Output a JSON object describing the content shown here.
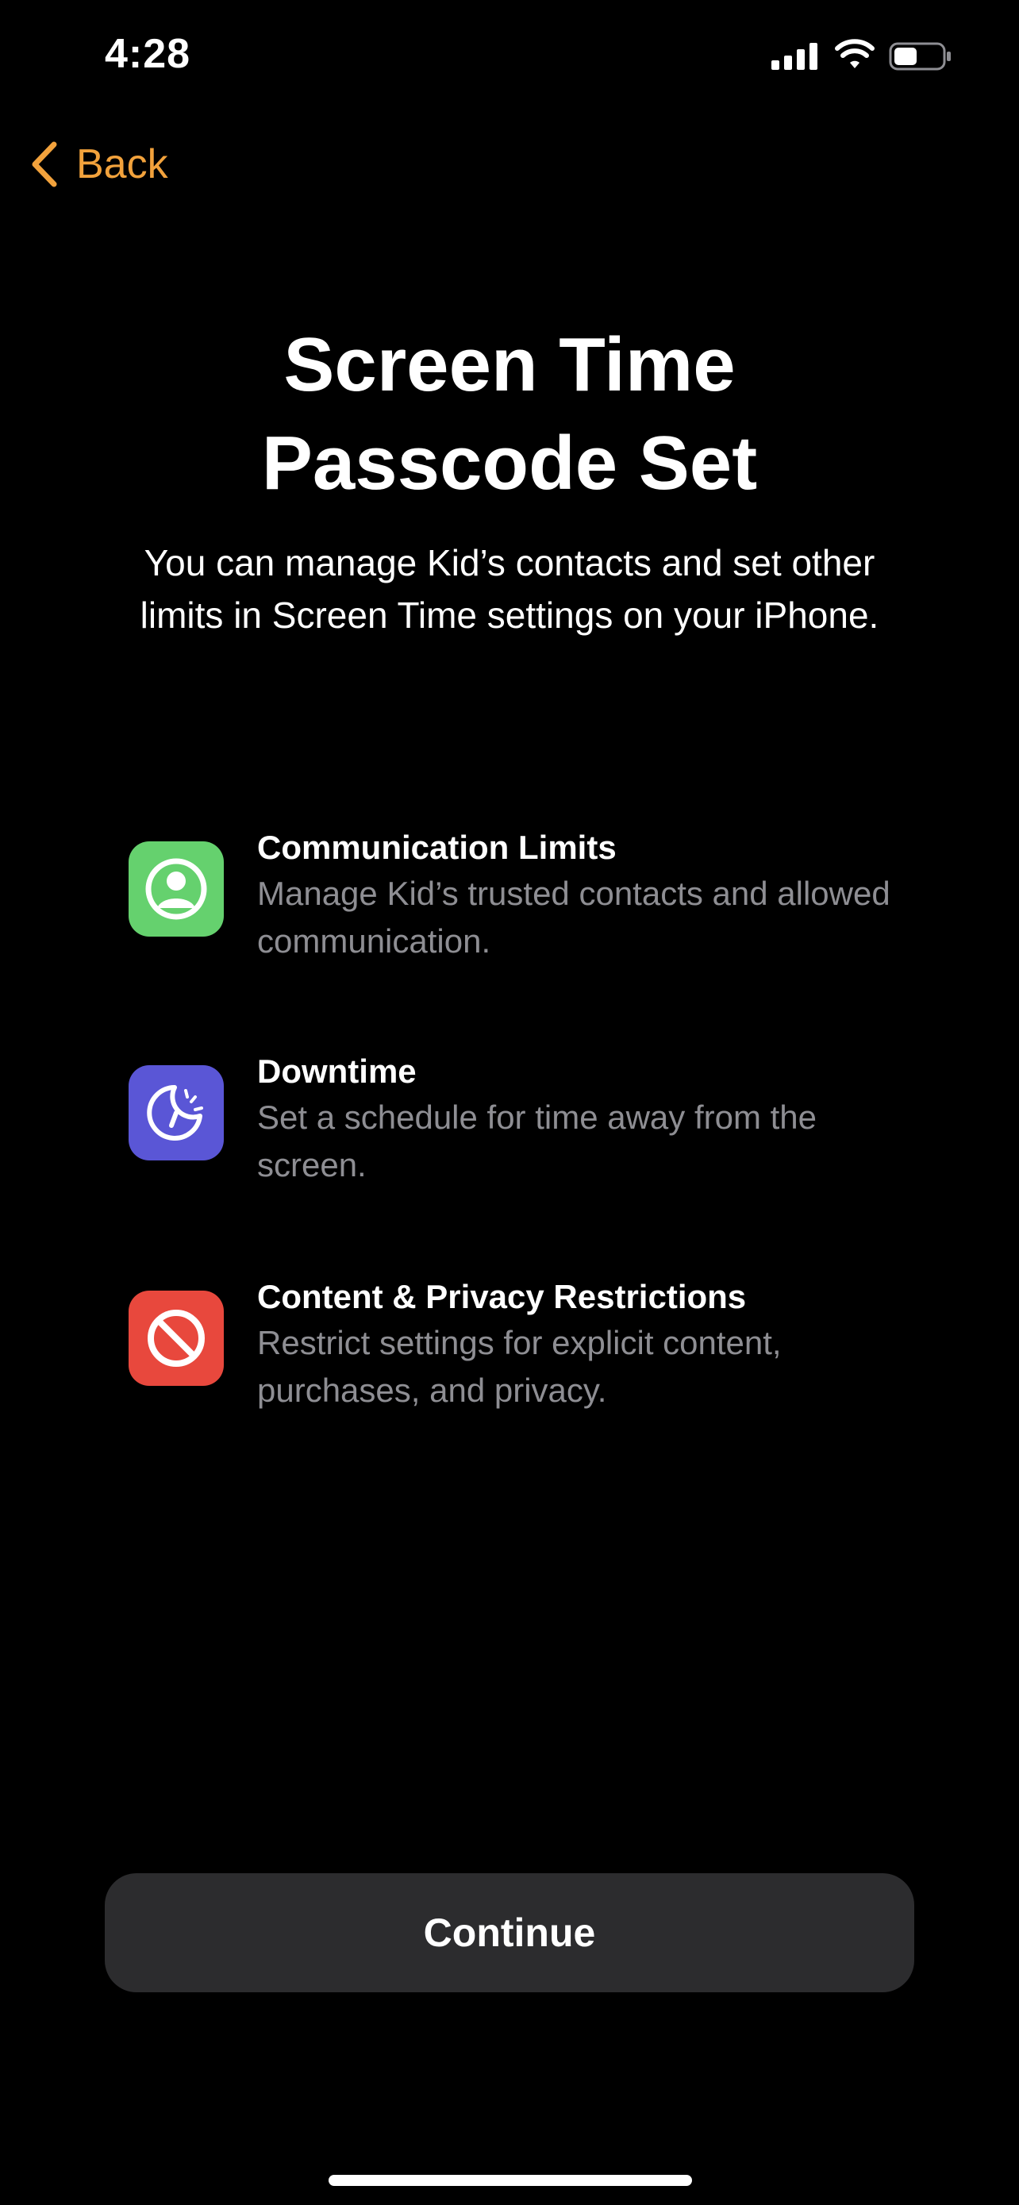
{
  "status_bar": {
    "time": "4:28",
    "signal_icon": "cellular-signal-icon",
    "wifi_icon": "wifi-icon",
    "battery_icon": "battery-icon"
  },
  "nav": {
    "back_label": "Back",
    "back_icon": "chevron-left-icon",
    "accent_color": "#f2a23c"
  },
  "header": {
    "title_line1": "Screen Time",
    "title_line2": "Passcode Set",
    "subtitle": "You can manage Kid’s contacts and set other limits in Screen Time settings on your iPhone."
  },
  "features": [
    {
      "title": "Communication Limits",
      "description": "Manage Kid’s trusted contacts and allowed communication.",
      "icon": "person-circle-icon",
      "color": "#65d16e"
    },
    {
      "title": "Downtime",
      "description": "Set a schedule for time away from the screen.",
      "icon": "downtime-moon-icon",
      "color": "#5a56d6"
    },
    {
      "title": "Content & Privacy Restrictions",
      "description": "Restrict settings for explicit content, purchases, and privacy.",
      "icon": "restriction-icon",
      "color": "#e8483d"
    }
  ],
  "footer": {
    "continue_label": "Continue"
  }
}
